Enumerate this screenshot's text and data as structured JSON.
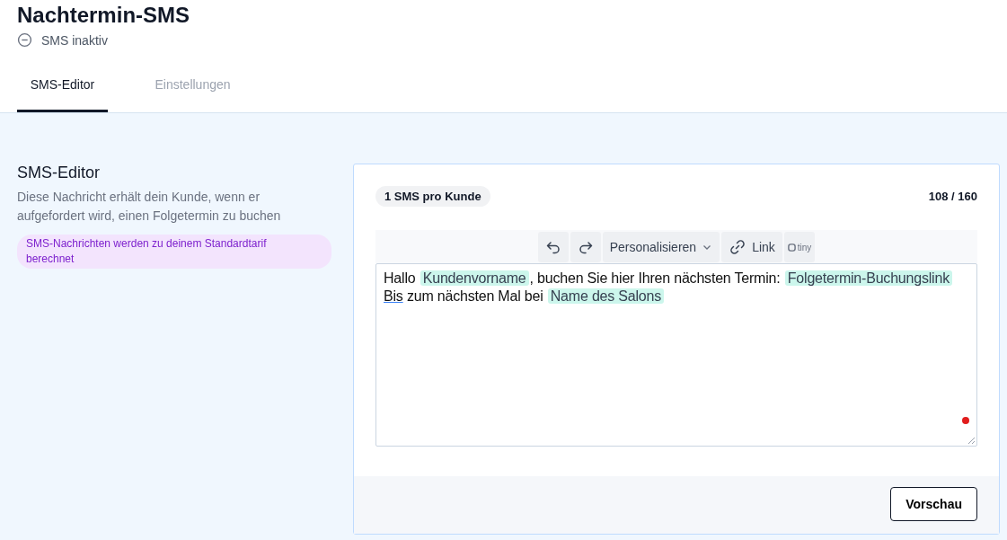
{
  "page": {
    "title": "Nachtermin-SMS",
    "status": "SMS inaktiv"
  },
  "tabs": [
    {
      "label": "SMS-Editor",
      "selected": true
    },
    {
      "label": "Einstellungen",
      "selected": false
    }
  ],
  "section": {
    "title": "SMS-Editor",
    "description": "Diese Nachricht erhält dein Kunde, wenn er aufgefordert wird, einen Folgetermin zu buchen",
    "notice": "SMS-Nachrichten werden zu deinem Standardtarif berechnet"
  },
  "editor": {
    "badge": "1 SMS pro Kunde",
    "counter": "108 / 160",
    "toolbar": {
      "personalize": "Personalisieren",
      "link": "Link",
      "brand": "tiny"
    },
    "lines": [
      [
        {
          "kind": "text",
          "text": "Hallo "
        },
        {
          "kind": "tag",
          "text": "Kundenvorname"
        },
        {
          "kind": "text",
          "text": ", buchen Sie hier Ihren nächsten Termin: "
        },
        {
          "kind": "tag",
          "text": "Folgetermin-Buchungslink"
        }
      ],
      [
        {
          "kind": "misspelled",
          "text": "Bis"
        },
        {
          "kind": "text",
          "text": " zum nächsten Mal bei "
        },
        {
          "kind": "tag",
          "text": "Name des Salons"
        }
      ]
    ],
    "preview_button": "Vorschau"
  }
}
